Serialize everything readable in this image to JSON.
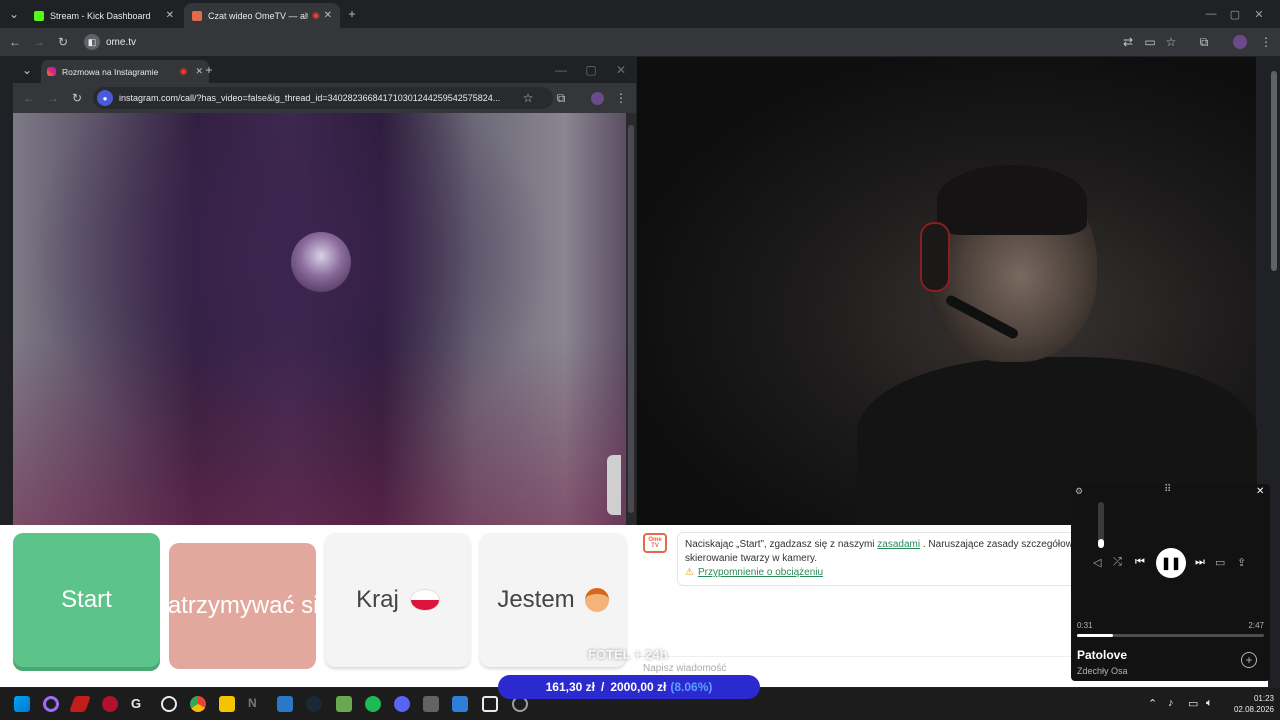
{
  "browser": {
    "tabs": [
      {
        "title": "Stream - Kick Dashboard",
        "favicon_color": "#53fc18"
      },
      {
        "title": "Czat wideo OmeTV — alter",
        "favicon_color": "#e36a4a"
      }
    ],
    "url": "ome.tv"
  },
  "instagram_window": {
    "tab_title": "Rozmowa na Instagramie",
    "url": "instagram.com/call/?has_video=false&ig_thread_id=340282366841710301244259542575824..."
  },
  "ometv": {
    "buttons": {
      "start": "Start",
      "stop": "Zatrzymywać się",
      "country": "Kraj",
      "gender": "Jestem"
    },
    "logo_text": "Ome TV",
    "notice": {
      "text_before": "Naciskając „Start”, zgadzasz się z naszymi ",
      "link": "zasadami",
      "text_after": " . Naruszające zasady szczegółowe skierowanie twarzy w kamery.",
      "reminder_link": "Przypomnienie o obciążeniu"
    },
    "message_placeholder": "Napisz wiadomość"
  },
  "overlay": {
    "tag": "FOTEL + 24h",
    "goal_current": "161,30 zł",
    "goal_separator": "/",
    "goal_target": "2000,00 zł",
    "goal_percent": "(8.06%)",
    "goal_color": "#2a2ad0"
  },
  "spotify": {
    "track": "Patolove",
    "artist": "Zdechły Osa",
    "elapsed": "0:31",
    "duration": "2:47",
    "progress_fraction": 0.19,
    "volume_fraction": 0.2
  },
  "taskbar": {
    "time": "01:23",
    "date": "02.08.2026"
  }
}
